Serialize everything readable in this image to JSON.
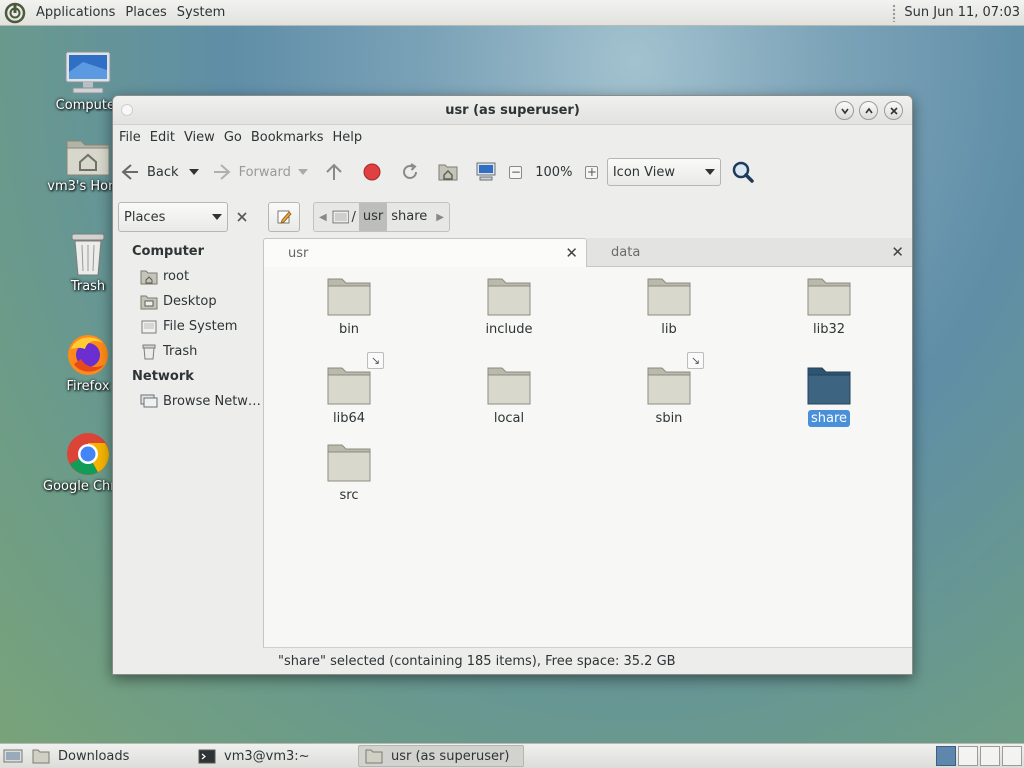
{
  "top_panel": {
    "menus": [
      "Applications",
      "Places",
      "System"
    ],
    "clock": "Sun Jun 11, 07:03"
  },
  "desktop_icons": [
    {
      "label": "Computer",
      "icon": "computer-icon"
    },
    {
      "label": "vm3's Home",
      "icon": "home-folder-icon"
    },
    {
      "label": "Trash",
      "icon": "trash-icon"
    },
    {
      "label": "Firefox",
      "icon": "firefox-icon"
    },
    {
      "label": "Google Chrome",
      "icon": "chrome-icon"
    }
  ],
  "window": {
    "title": "usr (as superuser)",
    "menus": [
      "File",
      "Edit",
      "View",
      "Go",
      "Bookmarks",
      "Help"
    ],
    "toolbar": {
      "back": "Back",
      "forward": "Forward",
      "zoom": "100%",
      "view_mode": "Icon View"
    },
    "location": {
      "places_label": "Places",
      "root_sep": "/",
      "crumbs": [
        "usr",
        "share"
      ],
      "active_crumb": "usr"
    },
    "sidebar": {
      "computer_header": "Computer",
      "computer_items": [
        {
          "label": "root",
          "icon": "home-folder-icon"
        },
        {
          "label": "Desktop",
          "icon": "desktop-folder-icon"
        },
        {
          "label": "File System",
          "icon": "drive-icon"
        },
        {
          "label": "Trash",
          "icon": "trash-icon"
        }
      ],
      "network_header": "Network",
      "network_items": [
        {
          "label": "Browse Netw…",
          "icon": "network-icon"
        }
      ]
    },
    "tabs": [
      {
        "label": "usr",
        "active": true
      },
      {
        "label": "data",
        "active": false
      }
    ],
    "files": [
      {
        "name": "bin",
        "link": false,
        "selected": false
      },
      {
        "name": "include",
        "link": false,
        "selected": false
      },
      {
        "name": "lib",
        "link": false,
        "selected": false
      },
      {
        "name": "lib32",
        "link": false,
        "selected": false
      },
      {
        "name": "lib64",
        "link": true,
        "selected": false
      },
      {
        "name": "local",
        "link": false,
        "selected": false
      },
      {
        "name": "sbin",
        "link": true,
        "selected": false
      },
      {
        "name": "share",
        "link": false,
        "selected": true
      },
      {
        "name": "src",
        "link": false,
        "selected": false
      }
    ],
    "status": "\"share\" selected (containing 185 items), Free space: 35.2 GB"
  },
  "taskbar": {
    "tasks": [
      {
        "label": "Downloads",
        "icon": "folder-icon"
      },
      {
        "label": "vm3@vm3:~",
        "icon": "terminal-icon"
      },
      {
        "label": "usr (as superuser)",
        "icon": "folder-icon"
      }
    ]
  },
  "colors": {
    "selection": "#4a90d9",
    "folder": "#d8d8cc",
    "folder_selected": "#3d6582"
  }
}
